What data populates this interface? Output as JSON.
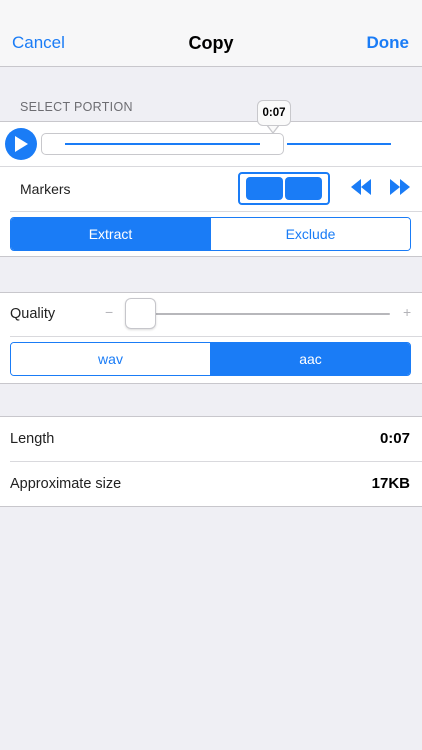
{
  "nav": {
    "cancel_label": "Cancel",
    "title": "Copy",
    "done_label": "Done"
  },
  "select_portion": {
    "header": "SELECT PORTION",
    "playhead_time": "0:07",
    "position_fraction": 0.62
  },
  "markers": {
    "label": "Markers"
  },
  "mode": {
    "options": [
      "Extract",
      "Exclude"
    ],
    "selected": "Extract"
  },
  "quality": {
    "label": "Quality",
    "minus": "−",
    "plus": "+",
    "level_fraction": 0.0
  },
  "format": {
    "options": [
      "wav",
      "aac"
    ],
    "selected": "aac"
  },
  "info": {
    "length_label": "Length",
    "length_value": "0:07",
    "size_label": "Approximate size",
    "size_value": "17KB"
  },
  "colors": {
    "accent": "#1a7cf6",
    "background": "#efeff4"
  },
  "icons": [
    "play-icon",
    "rewind-icon",
    "fast-forward-icon"
  ]
}
